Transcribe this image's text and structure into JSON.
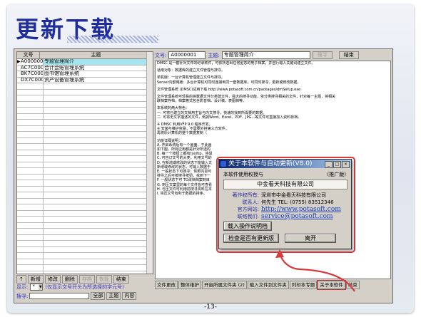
{
  "slide": {
    "title": "更新下载",
    "page_number": "-13-"
  },
  "list": {
    "headers": [
      "文号",
      "主题"
    ],
    "rows": [
      {
        "code": "A0000001",
        "subject": "专题管理简介"
      },
      {
        "code": "AC7C0001",
        "subject": "合计会账管理系统"
      },
      {
        "code": "BK7C0001",
        "subject": "图书馆管理系统"
      },
      {
        "code": "DX7C0001",
        "subject": "资产设备管理系统"
      }
    ],
    "selected_marker": "▶"
  },
  "left_toolbar": {
    "buttons": [
      {
        "label": "↑",
        "enabled": true
      },
      {
        "label": "新增",
        "enabled": true
      },
      {
        "label": "修改",
        "enabled": true
      },
      {
        "label": "删除",
        "enabled": true
      },
      {
        "label": "存档",
        "enabled": false
      },
      {
        "label": "恢复",
        "enabled": false
      },
      {
        "label": "结束",
        "enabled": true
      }
    ]
  },
  "display_row": {
    "label": "显示:",
    "value": "*",
    "note": "(仅显示文号开头为所选择的字元号)"
  },
  "search_row": {
    "label": "搜寻:",
    "value": "",
    "btn_all": "全部",
    "btn_topic": "主题",
    "btn_content": "内容"
  },
  "right_top": {
    "doc_label": "文号:",
    "doc_value": "A0000001",
    "topic_label": "主题:",
    "topic_value": "专题管理简介",
    "search_btn": "搜寻",
    "end_btn": "结束"
  },
  "doc_lines": [
    "DMSC 是一套针对文件的纪录软件，可依所选出任何型态的电子档案，并自行输入关键词建立文件。",
    "",
    "适用对象：数据库的建立文件管理与搜寻。",
    "",
    "单机版：一台计算机管理建立文件与搜寻。",
    "Server内部网版：多台计算机可同时连接到同一套数据库，可同时搜寻、更新或修改数据。",
    "",
    "文件管理系统 (DMSC)试用下载  http://www.potasoft.com.cn/packages/dmSetup.exe",
    "",
    "文件管理系统可轻易的将数据文件分类建文件，强大的搜寻功能，依分类搜寻相关的文件，针对每一主题，将相关",
    "联档案存档，档案格式包含影音档、设计稿、表图档等。",
    "",
    "本系统的两大特色：",
    "一. 可将已建立的文档用主旨与内文搜寻，快速的找到所需要的数据。",
    "二. 可将无文字描述的文件，例如Word、Excel、PDF、JPG...等文件可直接加入资料存档。",
    "",
    "※ DMSC 利用VFP 9.0 程序开发，",
    "※ 安装与维护容易，不需要外挂第三方软件，",
    "再将原计算机的整个数据复制（",
    "",
    "功能详细说明：",
    "A. 开启系统后有一个画面，于此画",
    "如下图，所有应用都是针对所选的",
    "B. 每一个按钮上都有tooltip，将鼠",
    "C. 可自订文号的大类，利用文号的",
    "D. 在新增或修改的状态下能输入文",
    "新增或修改的状态，可输入数据于",
    "E. 一般状态下可搜寻：依照内容可",
    "搜寻之后可按搜寻按钮，找到下一",
    "F. 一般状态下可 TO改档档案到目",
    "G. 到压文案里的每个文件皆可查看",
    "H. 与压文件可利用前搜寻资料在本",
    "I. 将压文号有利于数据的排序。"
  ],
  "right_bottom_buttons": [
    {
      "label": "文件更改",
      "highlight": false
    },
    {
      "label": "整体维护",
      "highlight": false
    },
    {
      "label": "开启所属文件夹 (2)",
      "highlight": false
    },
    {
      "label": "载入文件到文件夹",
      "highlight": false
    },
    {
      "label": "列印本专题",
      "highlight": false
    },
    {
      "label": "关于本软件",
      "highlight": true
    },
    {
      "label": "结束",
      "highlight": false
    }
  ],
  "dialog": {
    "title": "关于本软件与自动更新(V8.0)",
    "licensed_to_label": "本软件使用权授与",
    "edition": "(推广版)",
    "company": "中金看天科技有限公司",
    "info": [
      {
        "key": "著作权所有:",
        "value": "深圳市中金看天科技有限公司",
        "type": "text"
      },
      {
        "key": "联系人:",
        "value": "何先生 TEL: (0755) 83512346",
        "type": "text"
      },
      {
        "key": "官方网站:",
        "value": "http://www.potasoft.com",
        "type": "url"
      },
      {
        "key": "联络我们:",
        "value": "service@potasoft.com",
        "type": "url"
      }
    ],
    "btn_manual": "载入操作说明档",
    "btn_update": "检查是否有更新版",
    "btn_close": "离开"
  },
  "colors": {
    "title_blue": "#1f2d9c",
    "selected_row": "#a4e6f0",
    "annotation_red": "#d63a3a"
  }
}
